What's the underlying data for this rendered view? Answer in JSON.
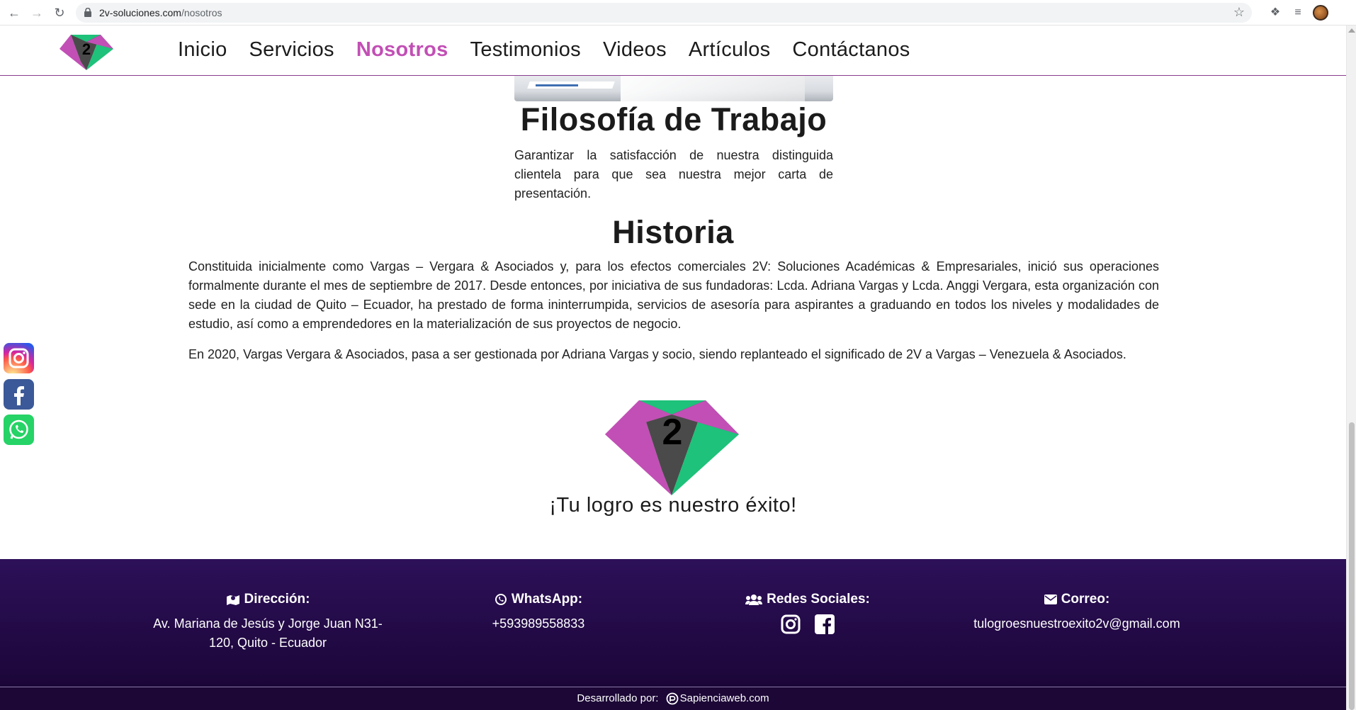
{
  "browser": {
    "url_domain": "2v-soluciones.com",
    "url_path": "/nosotros",
    "back_icon": "back-arrow-icon",
    "forward_icon": "forward-arrow-icon",
    "reload_icon": "reload-icon"
  },
  "header": {
    "nav": [
      {
        "label": "Inicio",
        "active": false
      },
      {
        "label": "Servicios",
        "active": false
      },
      {
        "label": "Nosotros",
        "active": true
      },
      {
        "label": "Testimonios",
        "active": false
      },
      {
        "label": "Videos",
        "active": false
      },
      {
        "label": "Artículos",
        "active": false
      },
      {
        "label": "Contáctanos",
        "active": false
      }
    ],
    "active_color": "#c24fb5",
    "logo_text": "2"
  },
  "content": {
    "filosofia_title": "Filosofía de Trabajo",
    "filosofia_text": "Garantizar la satisfacción de nuestra distinguida clientela para que sea nuestra mejor carta de presentación.",
    "historia_title": "Historia",
    "historia_p1": "Constituida inicialmente como Vargas – Vergara & Asociados y, para los efectos comerciales 2V: Soluciones Académicas & Empresariales, inició sus operaciones formalmente durante el mes de septiembre de 2017. Desde entonces, por iniciativa de sus fundadoras: Lcda. Adriana Vargas y Lcda. Anggi Vergara, esta organización con sede en la ciudad de Quito – Ecuador, ha prestado de forma ininterrumpida, servicios de asesoría para aspirantes a graduando en todos los niveles y modalidades de estudio, así como a emprendedores en la materialización de sus proyectos de negocio.",
    "historia_p2": "En 2020, Vargas Vergara & Asociados, pasa a ser gestionada por Adriana Vargas y socio, siendo replanteado el significado de 2V a Vargas – Venezuela & Asociados.",
    "logo_text": "2",
    "slogan": "¡Tu logro es nuestro éxito!"
  },
  "floating_social": [
    "instagram-icon",
    "facebook-icon",
    "whatsapp-icon"
  ],
  "footer": {
    "direccion_label": "Dirección:",
    "direccion_value": "Av. Mariana de Jesús y Jorge Juan N31-120, Quito - Ecuador",
    "whatsapp_label": "WhatsApp:",
    "whatsapp_value": "+593989558833",
    "redes_label": "Redes Sociales:",
    "correo_label": "Correo:",
    "correo_value": "tulogroesnuestroexito2v@gmail.com",
    "developed_by": "Desarrollado por:",
    "developer": "Sapienciaweb.com"
  },
  "colors": {
    "brand_pink": "#c24fb5",
    "brand_green": "#1ec27a",
    "brand_gray": "#4a4a4a",
    "footer_bg": "#2d1059"
  }
}
